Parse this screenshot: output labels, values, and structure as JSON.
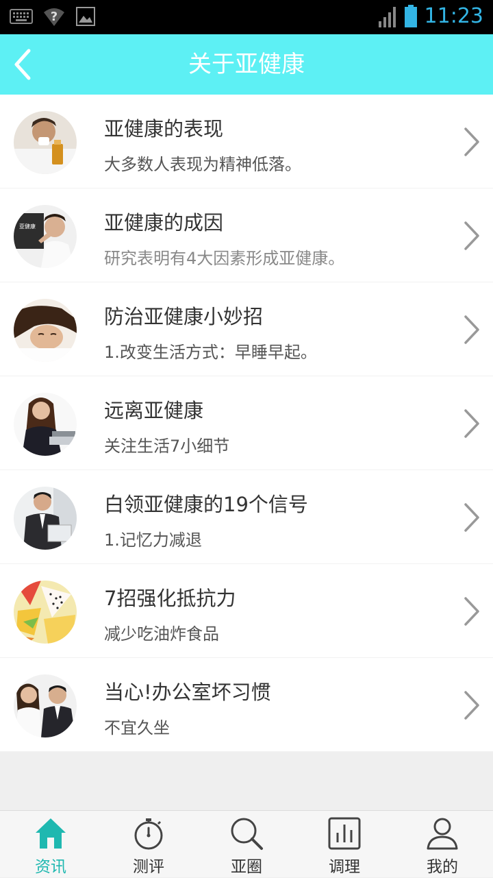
{
  "status_bar": {
    "time": "11:23",
    "icons": [
      "keyboard-icon",
      "wifi-unknown-icon",
      "image-icon",
      "signal-icon",
      "battery-icon"
    ]
  },
  "header": {
    "title": "关于亚健康",
    "back_icon": "chevron-left-icon"
  },
  "articles": [
    {
      "title": "亚健康的表现",
      "subtitle": "大多数人表现为精神低落。"
    },
    {
      "title": "亚健康的成因",
      "subtitle": "研究表明有4大因素形成亚健康。"
    },
    {
      "title": "防治亚健康小妙招",
      "subtitle": "1.改变生活方式：早睡早起。"
    },
    {
      "title": "远离亚健康",
      "subtitle": "关注生活7小细节"
    },
    {
      "title": "白领亚健康的19个信号",
      "subtitle": "1.记忆力减退"
    },
    {
      "title": "7招强化抵抗力",
      "subtitle": "减少吃油炸食品"
    },
    {
      "title": "当心!办公室坏习惯",
      "subtitle": "不宜久坐"
    }
  ],
  "tabs": [
    {
      "label": "资讯",
      "icon": "home-icon",
      "active": true
    },
    {
      "label": "测评",
      "icon": "stopwatch-icon",
      "active": false
    },
    {
      "label": "亚圈",
      "icon": "search-icon",
      "active": false
    },
    {
      "label": "调理",
      "icon": "chart-icon",
      "active": false
    },
    {
      "label": "我的",
      "icon": "user-icon",
      "active": false
    }
  ],
  "colors": {
    "accent": "#5df0f4",
    "tab_active": "#1fb8b0",
    "status_text": "#33b5e5"
  }
}
